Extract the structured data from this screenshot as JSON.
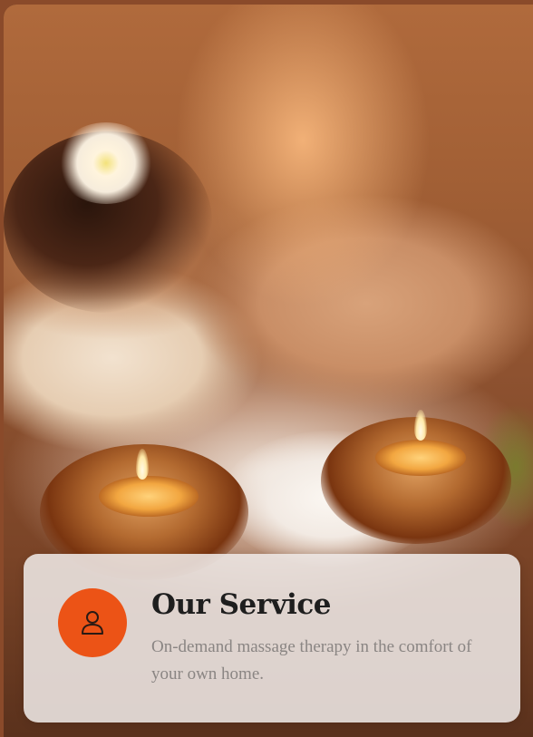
{
  "service": {
    "title": "Our Service",
    "description": "On-demand massage therapy in the comfort of your own home.",
    "icon": "user-icon",
    "icon_bg_color": "#ec5316"
  }
}
